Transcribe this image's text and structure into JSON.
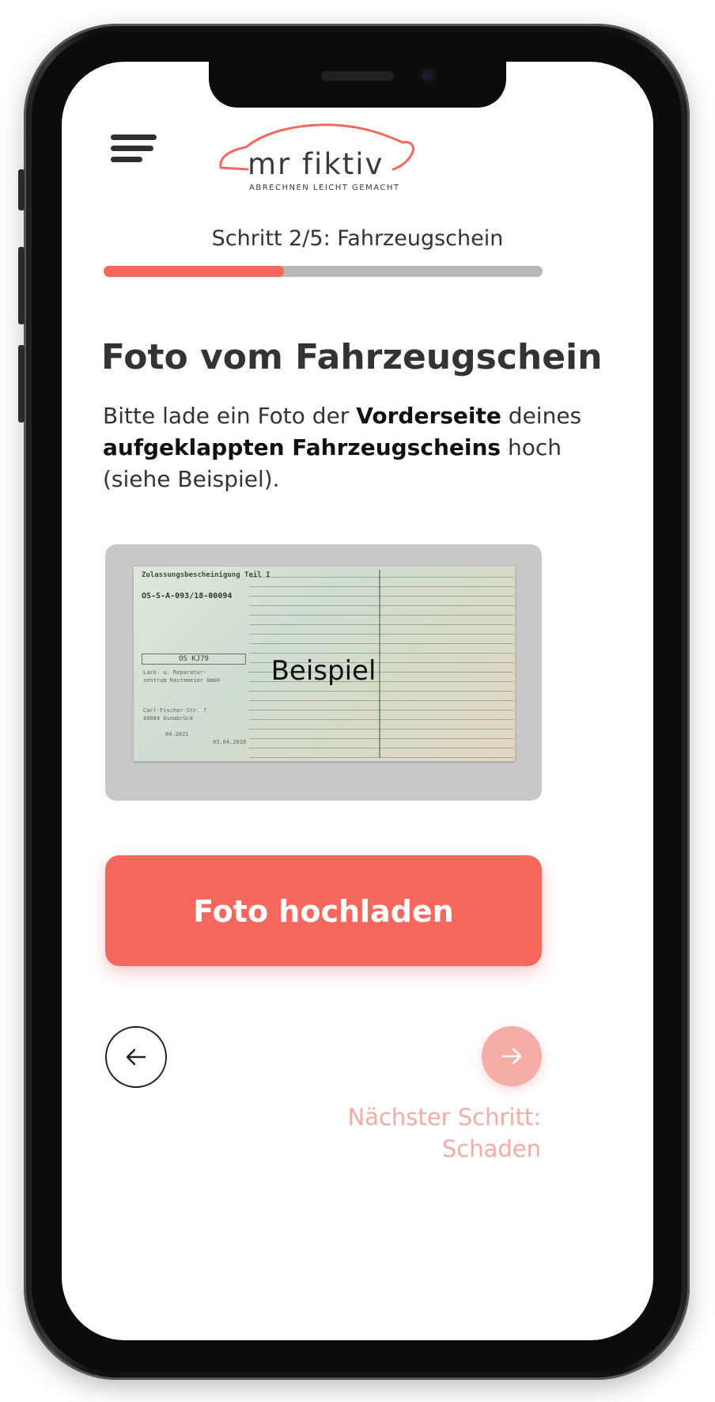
{
  "header": {
    "logo_text": "mr fiktiv",
    "logo_tagline": "ABRECHNEN LEICHT GEMACHT"
  },
  "progress": {
    "label": "Schritt 2/5: Fahrzeugschein",
    "fraction": 0.41
  },
  "main": {
    "heading": "Foto vom Fahrzeugschein",
    "description_part1": "Bitte lade ein Foto der ",
    "description_bold1": "Vorderseite",
    "description_part2": " deines ",
    "description_bold2": "aufgeklappten Fahrzeugscheins",
    "description_part3": " hoch (siehe Beispiel).",
    "example_label": "Beispiel",
    "example_doc": {
      "title": "Zulassungsbescheinigung Teil I",
      "number": "OS-S-A-093/18-00094",
      "plate": "OS KJ79",
      "line1": "Lack- u. Reparatur-",
      "line2": "zentrum Rastemeier GmbH",
      "line3": "Carl-Fischer-Str. 7",
      "line4": "49084 Osnabrück",
      "date1": "04.2021",
      "date2": "03.04.2018"
    },
    "upload_button": "Foto hochladen"
  },
  "navigation": {
    "back_icon": "arrow-left-icon",
    "next_icon": "arrow-right-icon",
    "next_label": "Nächster Schritt:\nSchaden"
  },
  "colors": {
    "accent": "#f4685e",
    "accent_light": "#f6aca6",
    "text": "#333333"
  }
}
